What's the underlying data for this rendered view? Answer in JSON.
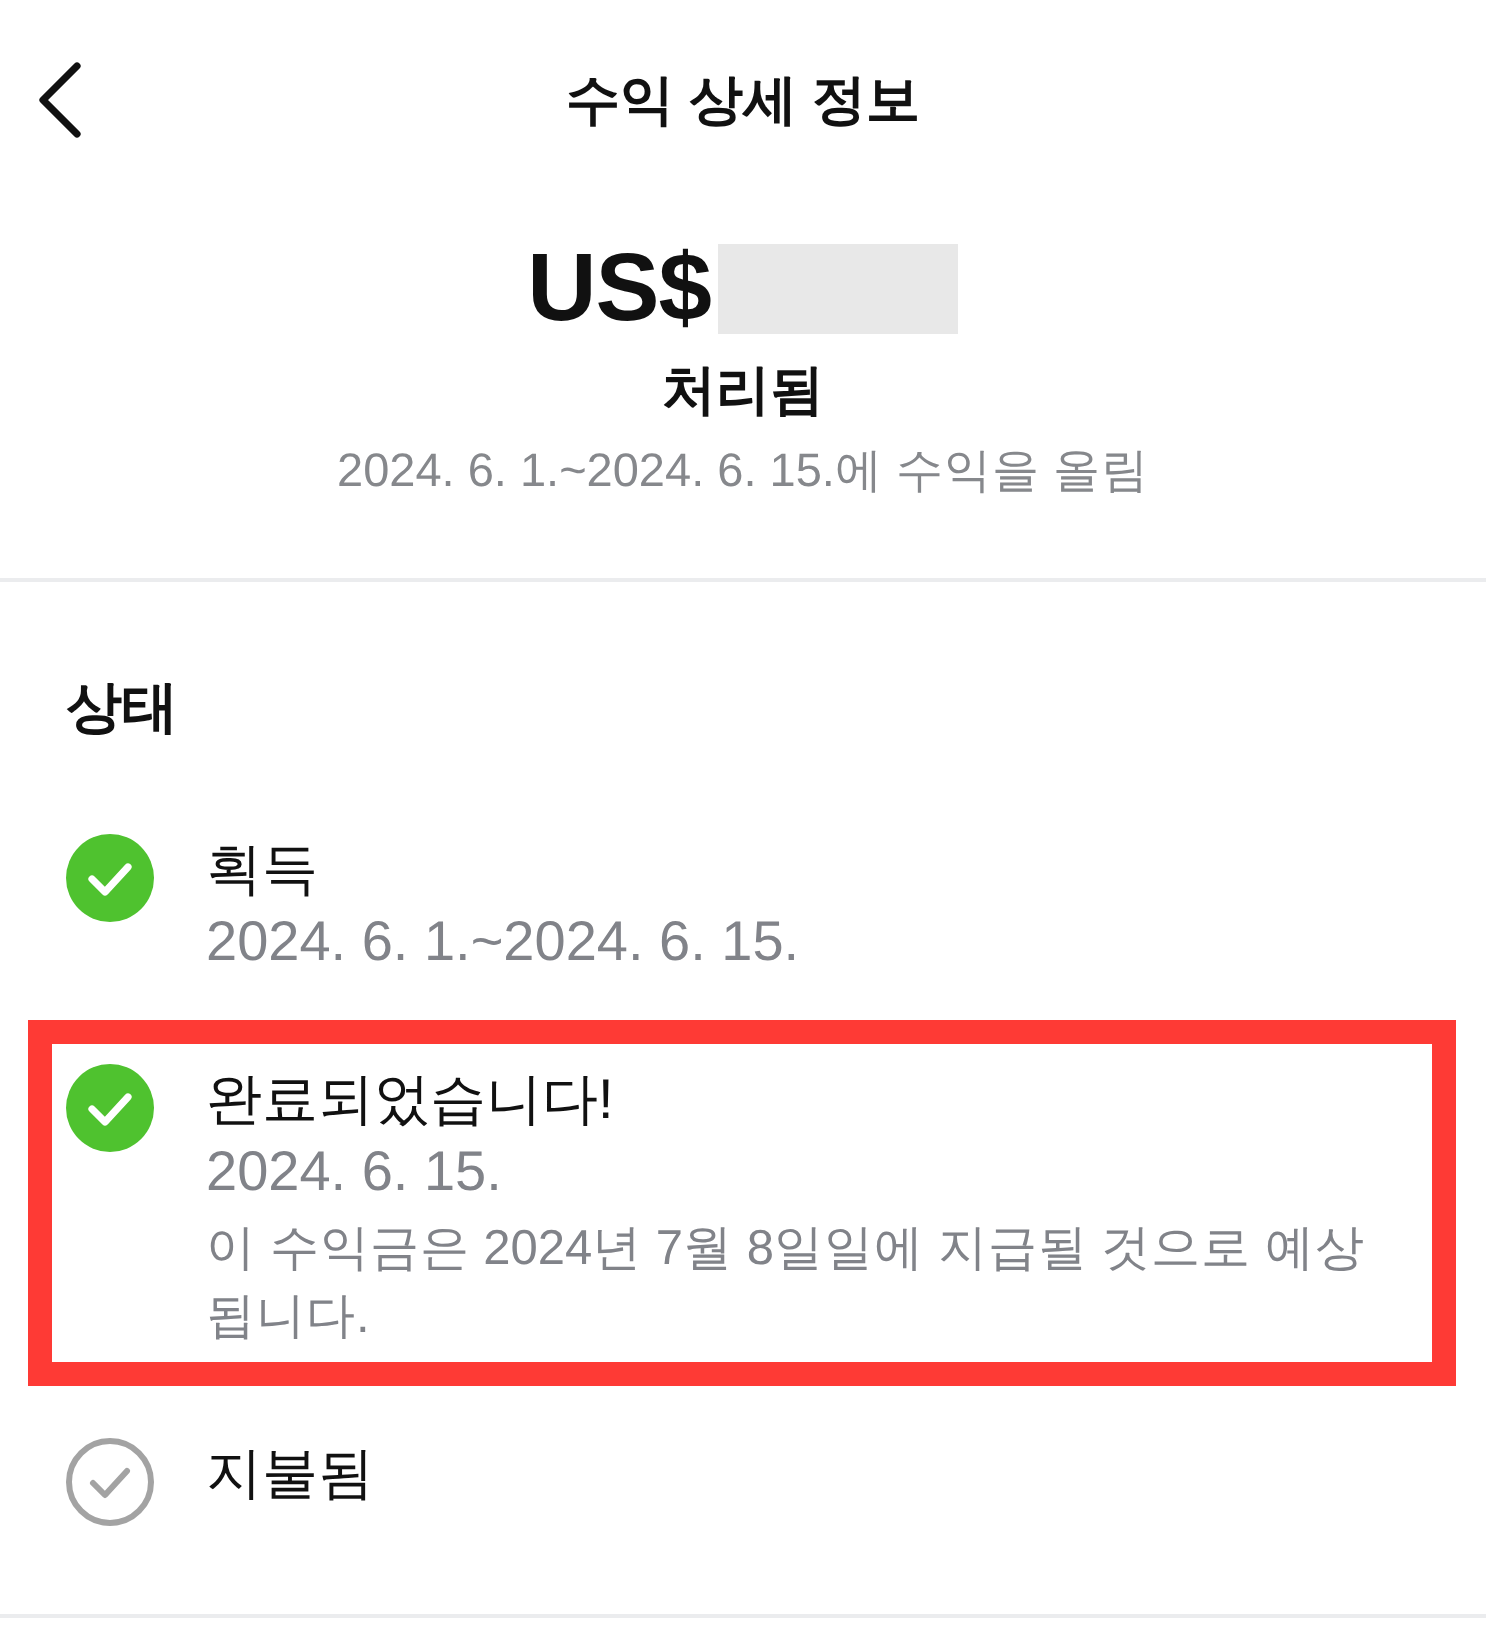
{
  "header": {
    "title": "수익 상세 정보"
  },
  "summary": {
    "currency": "US$",
    "amount_redacted": true,
    "status": "처리됨",
    "earning_period": "2024. 6. 1.~2024. 6. 15.에 수익을 올림"
  },
  "status_section": {
    "heading": "상태",
    "steps": [
      {
        "label": "획득",
        "date": "2024. 6. 1.~2024. 6. 15.",
        "done": true,
        "highlighted": false
      },
      {
        "label": "완료되었습니다!",
        "date": "2024. 6. 15.",
        "note": "이 수익금은 2024년 7월 8일일에 지급될 것으로 예상됩니다.",
        "done": true,
        "highlighted": true
      },
      {
        "label": "지불됨",
        "done": false,
        "highlighted": false
      }
    ]
  }
}
